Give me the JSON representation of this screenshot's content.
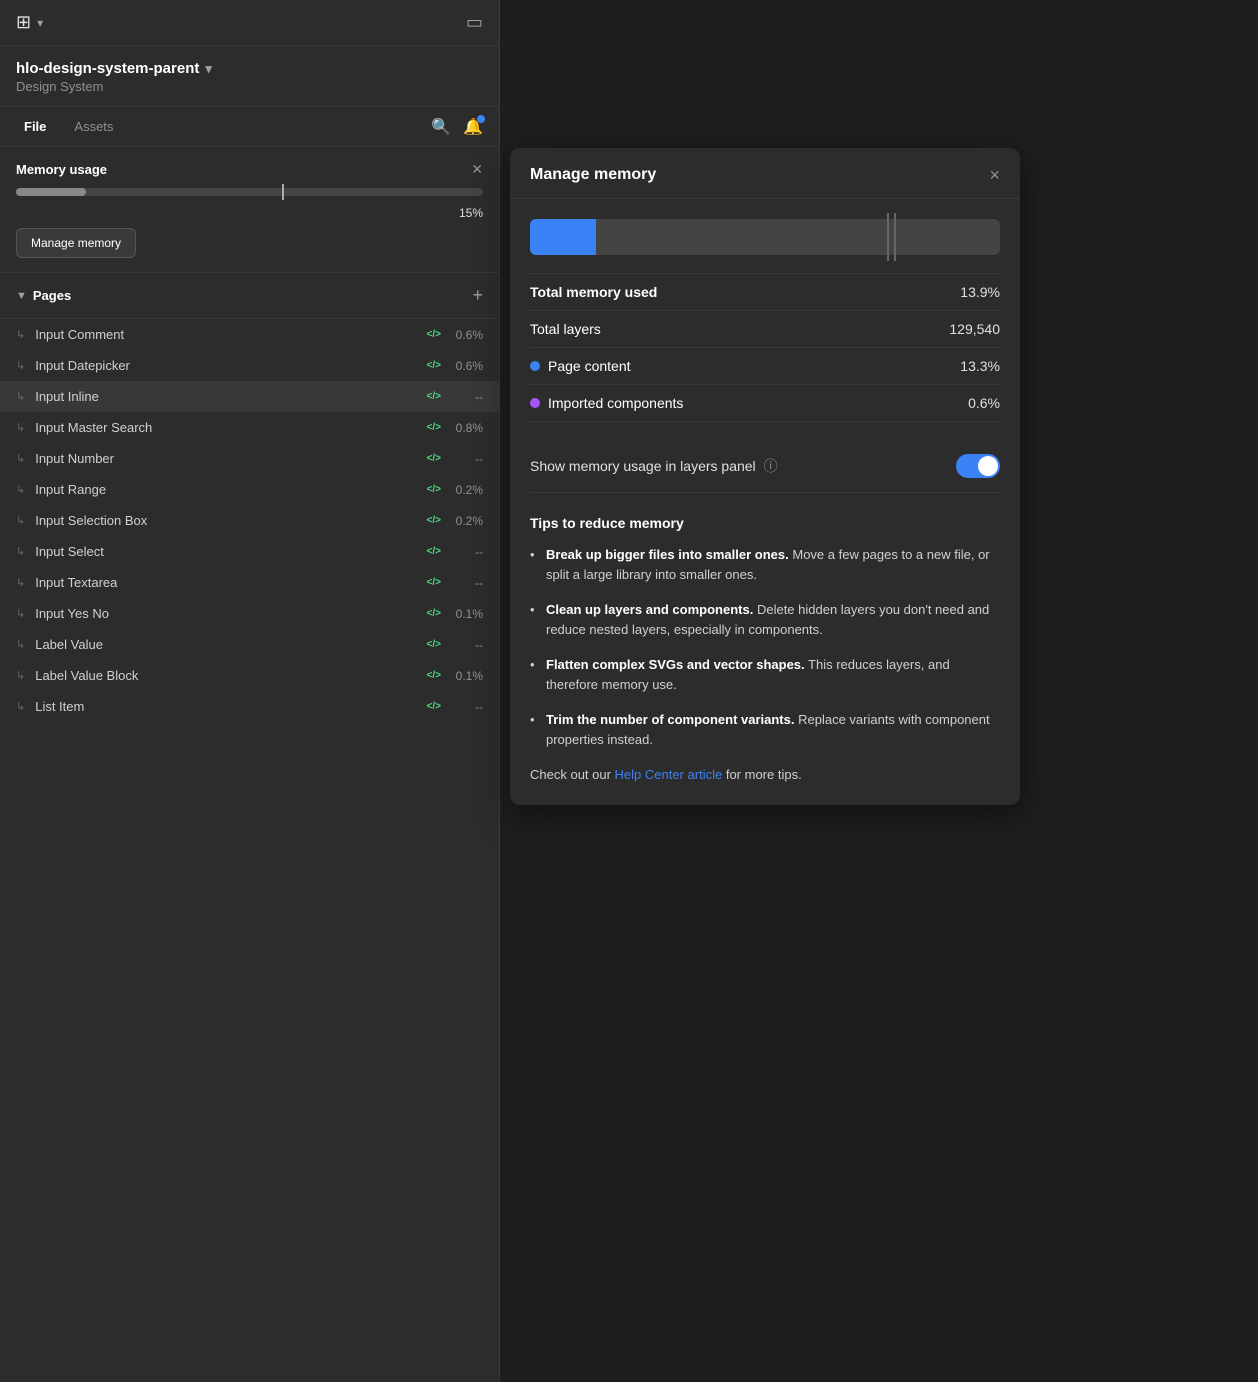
{
  "left_panel": {
    "logo_icon": "⊞",
    "project_name": "hlo-design-system-parent",
    "project_dropdown": "▾",
    "project_type": "Design System",
    "tabs": [
      {
        "label": "File",
        "active": true
      },
      {
        "label": "Assets",
        "active": false
      }
    ],
    "memory_section": {
      "title": "Memory usage",
      "percent": "15%",
      "manage_button": "Manage memory"
    },
    "pages_section": {
      "label": "Pages",
      "items": [
        {
          "name": "Input Comment",
          "percent": "0.6%",
          "active": false
        },
        {
          "name": "Input Datepicker",
          "percent": "0.6%",
          "active": false
        },
        {
          "name": "Input Inline",
          "percent": "--",
          "active": true
        },
        {
          "name": "Input Master Search",
          "percent": "0.8%",
          "active": false
        },
        {
          "name": "Input Number",
          "percent": "--",
          "active": false
        },
        {
          "name": "Input Range",
          "percent": "0.2%",
          "active": false
        },
        {
          "name": "Input Selection Box",
          "percent": "0.2%",
          "active": false
        },
        {
          "name": "Input Select",
          "percent": "--",
          "active": false
        },
        {
          "name": "Input Textarea",
          "percent": "--",
          "active": false
        },
        {
          "name": "Input Yes No",
          "percent": "0.1%",
          "active": false
        },
        {
          "name": "Label Value",
          "percent": "--",
          "active": false
        },
        {
          "name": "Label Value Block",
          "percent": "0.1%",
          "active": false
        },
        {
          "name": "List Item",
          "percent": "--",
          "active": false
        }
      ]
    }
  },
  "modal": {
    "title": "Manage memory",
    "close_label": "×",
    "total_memory_used_label": "Total memory used",
    "total_memory_used_value": "13.9%",
    "total_layers_label": "Total layers",
    "total_layers_value": "129,540",
    "page_content_label": "Page content",
    "page_content_value": "13.3%",
    "imported_components_label": "Imported components",
    "imported_components_value": "0.6%",
    "toggle_label": "Show memory usage in layers panel",
    "toggle_enabled": true,
    "tips_title": "Tips to reduce memory",
    "tips": [
      {
        "bold": "Break up bigger files into smaller ones.",
        "text": " Move a few pages to a new file, or split a large library into smaller ones."
      },
      {
        "bold": "Clean up layers and components.",
        "text": " Delete hidden layers you don’t need and reduce nested layers, especially in components."
      },
      {
        "bold": "Flatten complex SVGs and vector shapes.",
        "text": " This reduces layers, and therefore memory use."
      },
      {
        "bold": "Trim the number of component variants.",
        "text": " Replace variants with component properties instead."
      }
    ],
    "help_text_prefix": "Check out our ",
    "help_link_text": "Help Center article",
    "help_text_suffix": " for more tips."
  }
}
